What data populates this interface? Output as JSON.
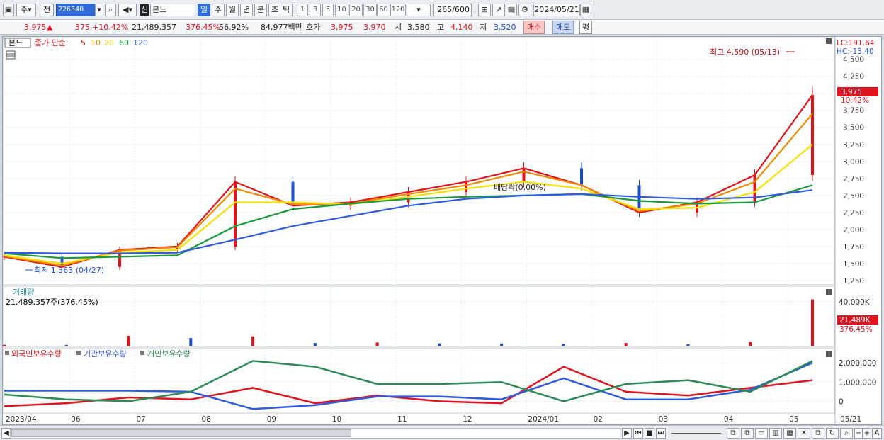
{
  "toolbar": {
    "market_type": "주",
    "prev_label": "전",
    "stock_code": "226340",
    "prefix_tag": "신",
    "stock_name": "본느",
    "periods": [
      "일",
      "주",
      "월",
      "년",
      "분",
      "초",
      "틱"
    ],
    "selected_period": "일",
    "intervals": [
      "1",
      "3",
      "5",
      "10",
      "20",
      "30",
      "60",
      "120"
    ],
    "count_display": "265",
    "count_total": "/600",
    "date": "2024/05/21"
  },
  "quote": {
    "price": "3,975",
    "arrow": "▲",
    "change": "375",
    "change_pct": "+10.42%",
    "volume": "21,489,357",
    "volume_pct": "376.45%",
    "turnover": "56.92%",
    "amount": "84,977백만",
    "ask_label": "호가",
    "ask": "3,975",
    "bid": "3,970",
    "open_label": "시",
    "open": "3,580",
    "high_label": "고",
    "high": "4,140",
    "low_label": "저",
    "low": "3,520",
    "buy_label": "매수",
    "sell_label": "매도",
    "flat_label": "평"
  },
  "price_panel": {
    "tab_label": "본느",
    "ma_prefix": "종가 단순",
    "ma_periods": [
      "5",
      "10",
      "20",
      "60",
      "120"
    ],
    "ma_colors": [
      "#e0141e",
      "#f08a00",
      "#f5e000",
      "#1a9a3a",
      "#2f5be0"
    ],
    "lc_label": "LC:191.64",
    "hc_label": "HC:-13.40",
    "high_note": "최고 4,590 (05/13)",
    "low_note": "최저 1,363 (04/27)",
    "dividend_note": "배당락(0.00%)",
    "current_price_box": "3,975",
    "current_pct": "10.42%"
  },
  "volume_panel": {
    "title": "거래량",
    "value_line": "21,489,357주(376.45%)",
    "box_value": "21,489K",
    "box_pct": "376.45%"
  },
  "holdings_panel": {
    "series_labels": [
      "외국인보유수량",
      "기관보유수량",
      "개인보유수량"
    ],
    "series_colors": [
      "#e0141e",
      "#2f5be0",
      "#2e8b57"
    ]
  },
  "x_labels": [
    "2023/04",
    "06",
    "07",
    "08",
    "09",
    "10",
    "11",
    "12",
    "2024/01",
    "02",
    "03",
    "04",
    "05",
    "05/21"
  ],
  "chart_data": [
    {
      "type": "line",
      "title": "본느",
      "y_ticks": [
        "4,500",
        "4,250",
        "4,000",
        "3,750",
        "3,500",
        "3,250",
        "3,000",
        "2,750",
        "2,500",
        "2,250",
        "2,000",
        "1,750",
        "1,500",
        "1,250"
      ],
      "ylim": [
        1250,
        4600
      ],
      "x": [
        "2023/04",
        "05",
        "06",
        "07",
        "08",
        "09",
        "10",
        "11",
        "12",
        "2024/01",
        "02",
        "03",
        "04",
        "05",
        "05/21"
      ],
      "series": [
        {
          "name": "5",
          "values": [
            1600,
            1450,
            1700,
            1750,
            2700,
            2350,
            2400,
            2550,
            2700,
            2900,
            2650,
            2250,
            2400,
            2800,
            3975
          ]
        },
        {
          "name": "10",
          "values": [
            1610,
            1470,
            1690,
            1740,
            2600,
            2370,
            2380,
            2520,
            2650,
            2850,
            2650,
            2270,
            2380,
            2700,
            3700
          ]
        },
        {
          "name": "20",
          "values": [
            1620,
            1500,
            1660,
            1700,
            2400,
            2400,
            2370,
            2480,
            2600,
            2700,
            2600,
            2300,
            2320,
            2550,
            3250
          ]
        },
        {
          "name": "60",
          "values": [
            1650,
            1580,
            1600,
            1620,
            2050,
            2300,
            2380,
            2450,
            2480,
            2500,
            2520,
            2420,
            2380,
            2400,
            2650
          ]
        },
        {
          "name": "120",
          "values": [
            1660,
            1650,
            1650,
            1660,
            1850,
            2050,
            2200,
            2350,
            2450,
            2500,
            2520,
            2480,
            2450,
            2470,
            2580
          ]
        }
      ],
      "annotations": [
        "최고 4,590 (05/13)",
        "최저 1,363 (04/27)",
        "배당락(0.00%)"
      ]
    },
    {
      "type": "bar",
      "title": "거래량",
      "y_ticks": [
        "40,000K"
      ],
      "ylim": [
        0,
        45000
      ],
      "x": [
        "2023/04",
        "06",
        "07",
        "08",
        "09",
        "10",
        "11",
        "12",
        "2024/01",
        "02",
        "03",
        "04",
        "05",
        "05/21"
      ],
      "values": [
        800,
        700,
        9000,
        7000,
        8500,
        2500,
        3000,
        2200,
        2000,
        1800,
        2500,
        1500,
        3500,
        42000
      ]
    },
    {
      "type": "line",
      "title": "보유수량",
      "y_ticks": [
        "2,000,000",
        "1,000,000",
        "0"
      ],
      "ylim": [
        -500000,
        2300000
      ],
      "x": [
        "2023/04",
        "06",
        "07",
        "08",
        "09",
        "10",
        "11",
        "12",
        "2024/01",
        "02",
        "03",
        "04",
        "05",
        "05/21"
      ],
      "series": [
        {
          "name": "외국인보유수량",
          "values": [
            -250000,
            -100000,
            200000,
            100000,
            700000,
            -100000,
            300000,
            0,
            -100000,
            1800000,
            500000,
            300000,
            700000,
            1100000
          ]
        },
        {
          "name": "기관보유수량",
          "values": [
            550000,
            550000,
            550000,
            500000,
            -400000,
            -200000,
            250000,
            250000,
            100000,
            1200000,
            100000,
            100000,
            600000,
            2000000
          ]
        },
        {
          "name": "개인보유수량",
          "values": [
            350000,
            100000,
            0,
            500000,
            2100000,
            1800000,
            900000,
            900000,
            1000000,
            0,
            900000,
            1100000,
            500000,
            2100000
          ]
        }
      ]
    }
  ]
}
